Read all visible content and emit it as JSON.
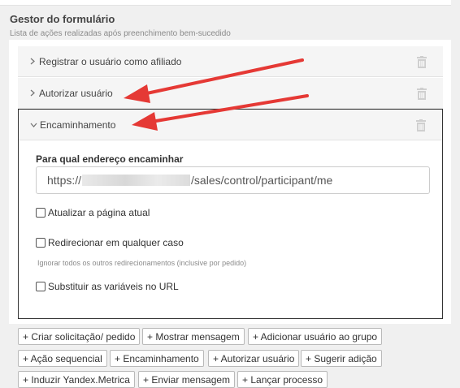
{
  "header": {
    "title": "Gestor do formulário",
    "subtitle": "Lista de ações realizadas após preenchimento bem-sucedido"
  },
  "actions": [
    {
      "label": "Registrar o usuário como afiliado",
      "icon": "chevron-right-icon"
    },
    {
      "label": "Autorizar usuário",
      "icon": "chevron-right-icon"
    }
  ],
  "expanded": {
    "label": "Encaminhamento",
    "icon": "chevron-down-icon",
    "redirect_label": "Para qual endereço encaminhar",
    "url_prefix": "https://",
    "url_suffix": "/sales/control/participant/me",
    "refresh_label": "Atualizar a página atual",
    "redirect_always_label": "Redirecionar em qualquer caso",
    "redirect_hint": "Ignorar todos os outros redirecionamentos (inclusive por pedido)",
    "replace_vars_label": "Substituir as variáveis no URL"
  },
  "add_buttons": [
    "+ Criar solicitação/ pedido",
    "+ Mostrar mensagem",
    "+ Adicionar usuário ao grupo",
    "+ Ação sequencial",
    "+ Encaminhamento",
    "+ Autorizar usuário",
    "+ Sugerir adição",
    "+ Induzir Yandex.Metrica",
    "+ Enviar mensagem",
    "+ Lançar processo"
  ],
  "colors": {
    "arrow": "#e53935",
    "trash": "#cfcfcf"
  }
}
